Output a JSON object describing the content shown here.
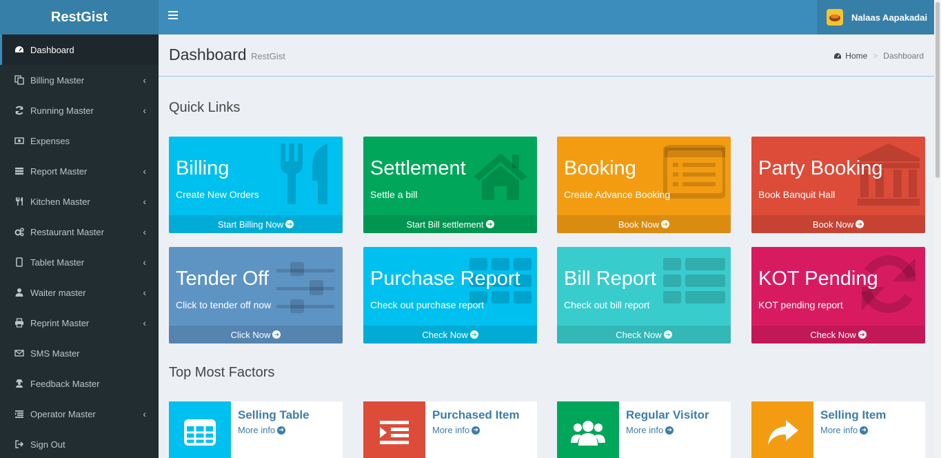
{
  "app": {
    "logo": "RestGist"
  },
  "user": {
    "name": "Nalaas Aapakadai"
  },
  "sidebar": {
    "items": [
      {
        "label": "Dashboard",
        "icon": "dashboard-icon",
        "active": true,
        "chevron": false
      },
      {
        "label": "Billing Master",
        "icon": "copy-icon",
        "chevron": true
      },
      {
        "label": "Running Master",
        "icon": "refresh-icon",
        "chevron": true
      },
      {
        "label": "Expenses",
        "icon": "money-icon",
        "chevron": false
      },
      {
        "label": "Report Master",
        "icon": "list-icon",
        "chevron": true
      },
      {
        "label": "Kitchen Master",
        "icon": "cutlery-icon",
        "chevron": true
      },
      {
        "label": "Restaurant Master",
        "icon": "cogs-icon",
        "chevron": true
      },
      {
        "label": "Tablet Master",
        "icon": "tablet-icon",
        "chevron": true
      },
      {
        "label": "Waiter master",
        "icon": "user-icon",
        "chevron": true
      },
      {
        "label": "Reprint Master",
        "icon": "print-icon",
        "chevron": true
      },
      {
        "label": "SMS Master",
        "icon": "envelope-icon",
        "chevron": false
      },
      {
        "label": "Feedback Master",
        "icon": "user-secret-icon",
        "chevron": false
      },
      {
        "label": "Operator Master",
        "icon": "operator-list-icon",
        "chevron": true
      },
      {
        "label": "Sign Out",
        "icon": "sign-out-icon",
        "chevron": false
      }
    ]
  },
  "content": {
    "title": "Dashboard",
    "subtitle": "RestGist",
    "breadcrumb": {
      "home": "Home",
      "current": "Dashboard",
      "separator": ">"
    },
    "quick_links_title": "Quick Links",
    "factors_title": "Top Most Factors"
  },
  "tiles": [
    {
      "title": "Billing",
      "sub": "Create New Orders",
      "foot": "Start Billing Now",
      "color": "#00c0ef",
      "icon": "cutlery-icon"
    },
    {
      "title": "Settlement",
      "sub": "Settle a bill",
      "foot": "Start Bill settlement",
      "color": "#00a65a",
      "icon": "home-icon"
    },
    {
      "title": "Booking",
      "sub": "Create Advance Booking",
      "foot": "Book Now",
      "color": "#f39c12",
      "icon": "list-alt-icon"
    },
    {
      "title": "Party Booking",
      "sub": "Book Banquit Hall",
      "foot": "Book Now",
      "color": "#dd4b39",
      "icon": "bank-icon"
    },
    {
      "title": "Tender Off",
      "sub": "Click to tender off now",
      "foot": "Click Now",
      "color": "#5e94c3",
      "icon": "sliders-icon"
    },
    {
      "title": "Purchase Report",
      "sub": "Check out purchase report",
      "foot": "Check Now",
      "color": "#00c0ef",
      "icon": "th-icon"
    },
    {
      "title": "Bill Report",
      "sub": "Check out bill report",
      "foot": "Check Now",
      "color": "#39cccc",
      "icon": "th-list-icon"
    },
    {
      "title": "KOT Pending",
      "sub": "KOT pending report",
      "foot": "Check Now",
      "color": "#d81b60",
      "icon": "refresh-icon"
    }
  ],
  "factors": [
    {
      "title": "Selling Table",
      "more": "More info",
      "color": "#00c0ef",
      "icon": "table-icon"
    },
    {
      "title": "Purchased Item",
      "more": "More info",
      "color": "#dd4b39",
      "icon": "indent-icon"
    },
    {
      "title": "Regular Visitor",
      "more": "More info",
      "color": "#00a65a",
      "icon": "users-icon"
    },
    {
      "title": "Selling Item",
      "more": "More info",
      "color": "#f39c12",
      "icon": "share-icon"
    }
  ]
}
